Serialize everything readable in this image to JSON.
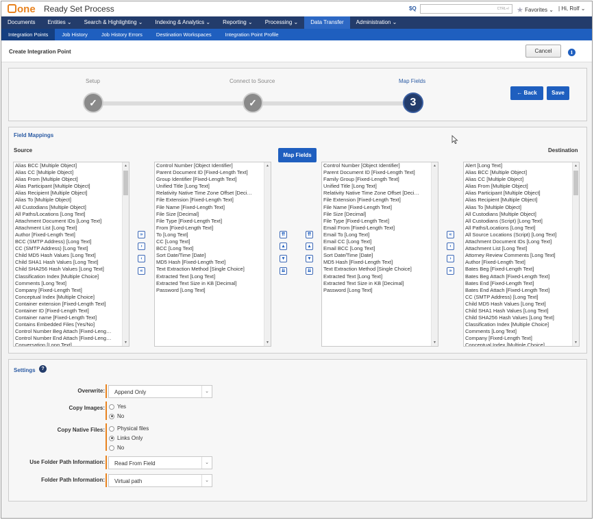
{
  "app": {
    "logo_text": "one",
    "title": "Ready Set Process",
    "search_prefix": "$Q",
    "search_shortcut": "CTRL+/",
    "favorites_label": "Favorites",
    "user_label": "Hi, Rolf"
  },
  "nav": {
    "items": [
      "Documents",
      "Entities",
      "Search & Highlighting",
      "Indexing & Analytics",
      "Reporting",
      "Processing",
      "Data Transfer",
      "Administration"
    ],
    "active_index": 6
  },
  "subnav": {
    "items": [
      "Integration Points",
      "Job History",
      "Job History Errors",
      "Destination Workspaces",
      "Integration Point Profile"
    ],
    "active_index": 0
  },
  "header": {
    "title": "Create Integration Point",
    "cancel_label": "Cancel"
  },
  "stepper": {
    "steps": [
      {
        "label": "Setup",
        "state": "done",
        "glyph": "✓"
      },
      {
        "label": "Connect to Source",
        "state": "done",
        "glyph": "✓"
      },
      {
        "label": "Map Fields",
        "state": "active",
        "glyph": "3"
      }
    ],
    "back_label": "← Back",
    "save_label": "Save"
  },
  "field_mappings": {
    "title": "Field Mappings",
    "source_label": "Source",
    "destination_label": "Destination",
    "map_fields_label": "Map Fields",
    "source_fields": [
      "Alias BCC [Multiple Object]",
      "Alias CC [Multiple Object]",
      "Alias From [Multiple Object]",
      "Alias Participant [Multiple Object]",
      "Alias Recipient [Multiple Object]",
      "Alias To [Multiple Object]",
      "All Custodians [Multiple Object]",
      "All Paths/Locations [Long Text]",
      "Attachment Document IDs [Long Text]",
      "Attachment List [Long Text]",
      "Author [Fixed-Length Text]",
      "BCC (SMTP Address) [Long Text]",
      "CC (SMTP Address) [Long Text]",
      "Child MD5 Hash Values [Long Text]",
      "Child SHA1 Hash Values [Long Text]",
      "Child SHA256 Hash Values [Long Text]",
      "Classification Index [Multiple Choice]",
      "Comments [Long Text]",
      "Company [Fixed-Length Text]",
      "Conceptual Index [Multiple Choice]",
      "Container extension [Fixed-Length Text]",
      "Container ID [Fixed-Length Text]",
      "Container name [Fixed-Length Text]",
      "Contains Embedded Files [Yes/No]",
      "Control Number Beg Attach [Fixed-Leng…",
      "Control Number End Attach [Fixed-Leng…",
      "Conversation [Long Text]"
    ],
    "mapped_source_fields": [
      "Control Number [Object Identifier]",
      "Parent Document ID [Fixed-Length Text]",
      "Group Identifier [Fixed-Length Text]",
      "Unified Title [Long Text]",
      "Relativity Native Time Zone Offset [Deci…",
      "File Extension [Fixed-Length Text]",
      "File Name [Fixed-Length Text]",
      "File Size [Decimal]",
      "File Type [Fixed-Length Text]",
      "From [Fixed-Length Text]",
      "To [Long Text]",
      "CC [Long Text]",
      "BCC [Long Text]",
      "Sort Date/Time [Date]",
      "MD5 Hash [Fixed-Length Text]",
      "Text Extraction Method [Single Choice]",
      "Extracted Text [Long Text]",
      "Extracted Text Size in KB [Decimal]",
      "Password [Long Text]"
    ],
    "mapped_destination_fields": [
      "Control Number [Object Identifier]",
      "Parent Document ID [Fixed-Length Text]",
      "Family Group [Fixed-Length Text]",
      "Unified Title [Long Text]",
      "Relativity Native Time Zone Offset [Deci…",
      "File Extension [Fixed-Length Text]",
      "File Name [Fixed-Length Text]",
      "File Size [Decimal]",
      "File Type [Fixed-Length Text]",
      "Email From [Fixed-Length Text]",
      "Email To [Long Text]",
      "Email CC [Long Text]",
      "Email BCC [Long Text]",
      "Sort Date/Time [Date]",
      "MD5 Hash [Fixed-Length Text]",
      "Text Extraction Method [Single Choice]",
      "Extracted Text [Long Text]",
      "Extracted Text Size in KB [Decimal]",
      "Password [Long Text]"
    ],
    "destination_fields": [
      "Alert [Long Text]",
      "Alias BCC [Multiple Object]",
      "Alias CC [Multiple Object]",
      "Alias From [Multiple Object]",
      "Alias Participant [Multiple Object]",
      "Alias Recipient [Multiple Object]",
      "Alias To [Multiple Object]",
      "All Custodians [Multiple Object]",
      "All Custodians (Script) [Long Text]",
      "All Paths/Locations [Long Text]",
      "All Source Locations (Script) [Long Text]",
      "Attachment Document IDs [Long Text]",
      "Attachment List [Long Text]",
      "Attorney Review Comments [Long Text]",
      "Author [Fixed-Length Text]",
      "Bates Beg [Fixed-Length Text]",
      "Bates Beg Attach [Fixed-Length Text]",
      "Bates End [Fixed-Length Text]",
      "Bates End Attach [Fixed-Length Text]",
      "CC (SMTP Address) [Long Text]",
      "Child MD5 Hash Values [Long Text]",
      "Child SHA1 Hash Values [Long Text]",
      "Child SHA256 Hash Values [Long Text]",
      "Classification Index [Multiple Choice]",
      "Comments [Long Text]",
      "Company [Fixed-Length Text]",
      "Conceptual Index [Multiple Choice]"
    ]
  },
  "settings": {
    "title": "Settings",
    "overwrite_label": "Overwrite:",
    "overwrite_value": "Append Only",
    "copy_images_label": "Copy Images:",
    "copy_images_options": [
      "Yes",
      "No"
    ],
    "copy_images_selected": 1,
    "copy_natives_label": "Copy Native Files:",
    "copy_natives_options": [
      "Physical files",
      "Links Only",
      "No"
    ],
    "copy_natives_selected": 1,
    "use_folder_label": "Use Folder Path Information:",
    "use_folder_value": "Read From Field",
    "folder_path_label": "Folder Path Information:",
    "folder_path_value": "Virtual path"
  },
  "colors": {
    "nav_bg": "#233c6b",
    "subnav_bg": "#1f5fbf",
    "accent": "#e8821e",
    "link_blue": "#2a5aa3"
  }
}
